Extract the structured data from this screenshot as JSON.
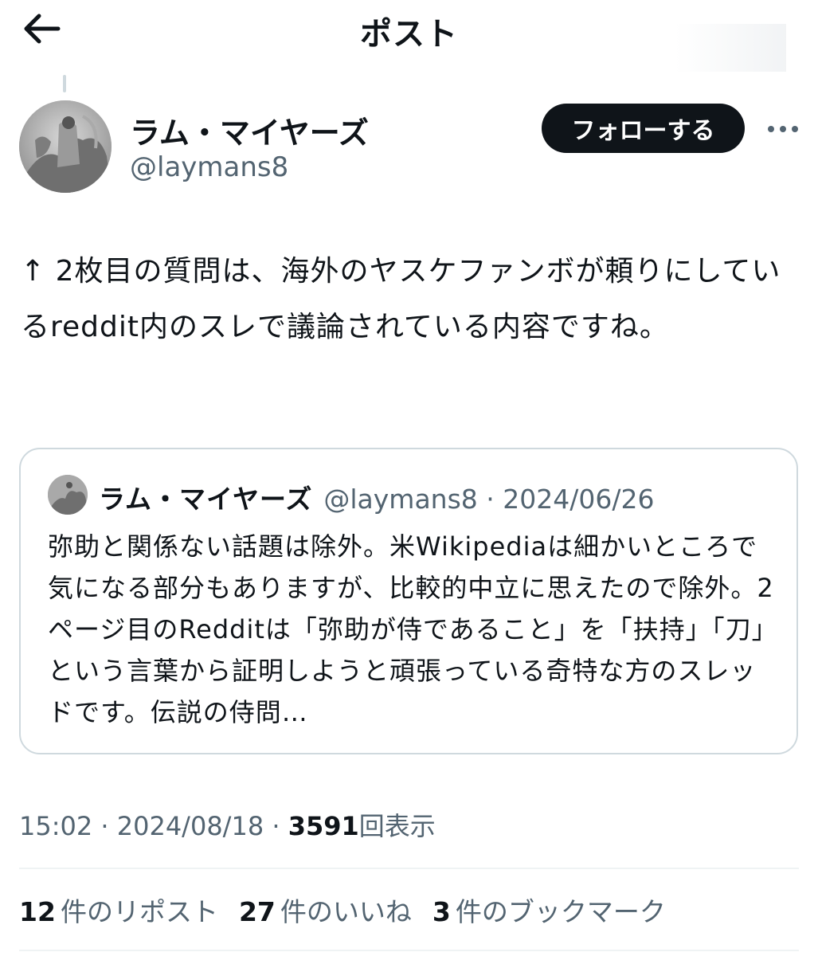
{
  "header": {
    "title": "ポスト",
    "back_icon": "arrow-left-icon"
  },
  "post": {
    "author": {
      "name": "ラム・マイヤーズ",
      "handle": "@laymans8"
    },
    "follow_label": "フォローする",
    "more_icon": "more-horizontal-icon",
    "text": "↑ 2枚目の質問は、海外のヤスケファンボが頼りにしているreddit内のスレで議論されている内容ですね。",
    "quote": {
      "name": "ラム・マイヤーズ",
      "handle_date": "@laymans8 · 2024/06/26",
      "text": "弥助と関係ない話題は除外。米Wikipediaは細かいところで気になる部分もありますが、比較的中立に思えたので除外。2ページ目のRedditは「弥助が侍であること」を「扶持」「刀」という言葉から証明しようと頑張っている奇特な方のスレッドです。伝説の侍問…"
    },
    "time_date": "15:02 · 2024/08/18 · ",
    "views_count": "3591",
    "views_label": "回表示",
    "stats": [
      {
        "count": "12",
        "label": "件のリポスト"
      },
      {
        "count": "27",
        "label": "件のいいね"
      },
      {
        "count": "3",
        "label": "件のブックマーク"
      }
    ]
  },
  "colors": {
    "text": "#0f1419",
    "secondary": "#536471",
    "border": "#cfd9de",
    "follow_bg": "#0f1419"
  }
}
